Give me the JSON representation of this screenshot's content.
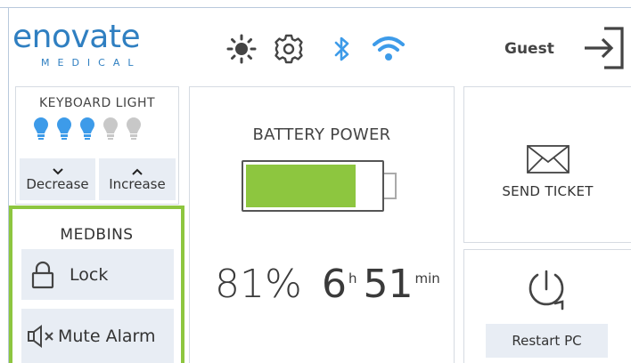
{
  "header": {
    "logo_word": "enovate",
    "logo_sub": "MEDICAL",
    "user_label": "Guest",
    "icons": [
      "brightness-icon",
      "settings-icon",
      "bluetooth-icon",
      "wifi-icon",
      "logout-icon"
    ]
  },
  "keyboard_light": {
    "title": "KEYBOARD LIGHT",
    "level": 3,
    "max_level": 5,
    "decrease_label": "Decrease",
    "increase_label": "Increase"
  },
  "medbins": {
    "title": "MEDBINS",
    "lock_label": "Lock",
    "mute_label": "Mute Alarm"
  },
  "battery": {
    "title": "BATTERY POWER",
    "percent": 81,
    "percent_text": "81%",
    "hours": "6",
    "hours_unit": "h",
    "minutes": "51",
    "minutes_unit": "min"
  },
  "ticket": {
    "label": "SEND TICKET"
  },
  "restart": {
    "label": "Restart PC"
  },
  "colors": {
    "brand": "#2f7fc1",
    "accent": "#8dc63f",
    "bulb_on": "#3d9be9",
    "bulb_off": "#c8c8c8",
    "button_bg": "#e8edf4"
  }
}
